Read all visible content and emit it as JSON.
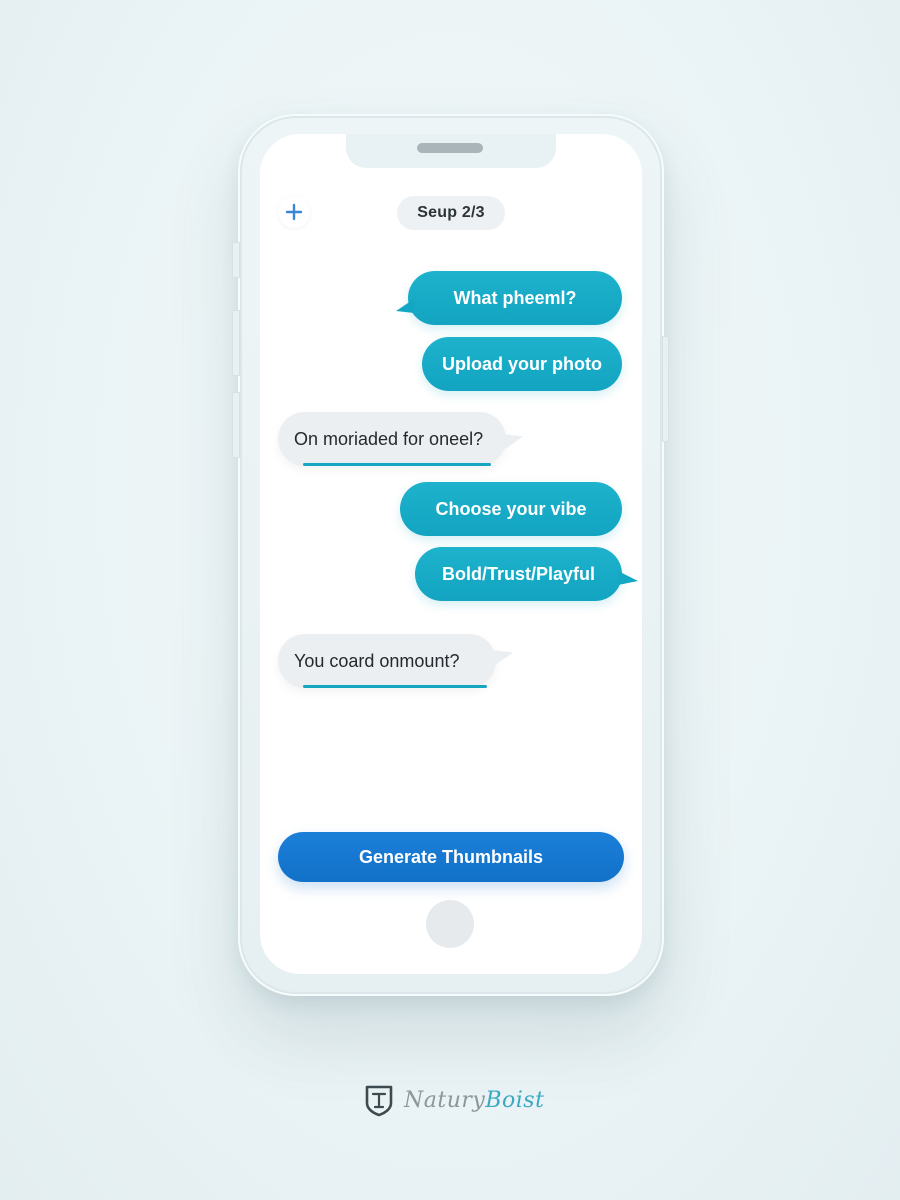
{
  "header": {
    "add_icon": "plus-icon",
    "step_label": "Seup 2/3"
  },
  "messages": [
    {
      "side": "out",
      "text": "What pheeml?"
    },
    {
      "side": "out",
      "text": "Upload your photo"
    },
    {
      "side": "in",
      "text": "On moriaded for oneel?"
    },
    {
      "side": "out",
      "text": "Choose your vibe"
    },
    {
      "side": "out",
      "text": "Bold/Trust/Playful"
    },
    {
      "side": "in",
      "text": "You coard onmount?"
    }
  ],
  "actions": {
    "generate_label": "Generate Thumbnails"
  },
  "brand": {
    "part1": "Natury",
    "part2": "Boist",
    "logo_icon": "shield-logo"
  },
  "colors": {
    "outgoing_bubble": "#14a7c3",
    "incoming_bubble": "#eceff2",
    "primary_button": "#1271c9",
    "background": "#eaf3f5"
  }
}
